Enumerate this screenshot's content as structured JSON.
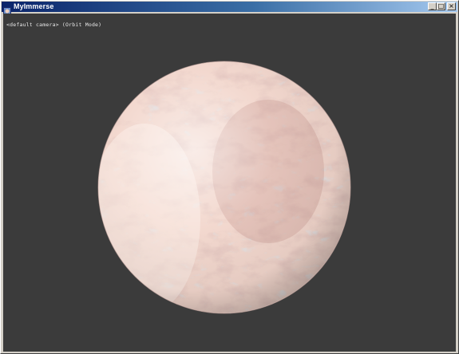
{
  "window": {
    "title": "MyImmerse",
    "buttons": {
      "minimize": "_",
      "maximize": "□",
      "close": "×"
    }
  },
  "viewport": {
    "camera_status": "<default camera> (Orbit Mode)",
    "background_color": "#3b3b3b"
  },
  "planet": {
    "description_icon": "textured-sphere",
    "base_color": "#f2d6cc",
    "mottle_color": "#c58f86",
    "ice_color": "#b9c9d6"
  }
}
